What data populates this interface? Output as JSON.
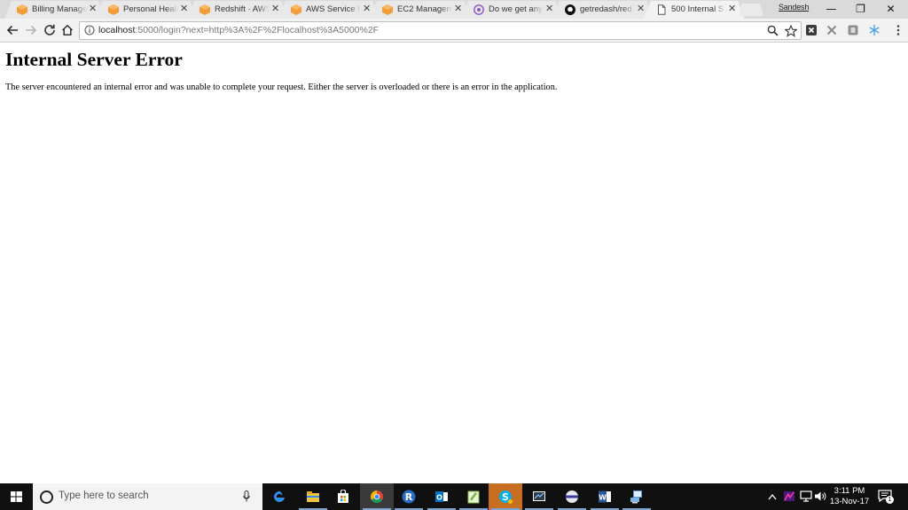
{
  "browser": {
    "tabs": [
      {
        "title": "Billing Manage",
        "icon": "aws-cube-icon",
        "active": false
      },
      {
        "title": "Personal Healt",
        "icon": "aws-cube-icon",
        "active": false
      },
      {
        "title": "Redshift · AWS",
        "icon": "aws-cube-icon",
        "active": false
      },
      {
        "title": "AWS Service H",
        "icon": "aws-cube-icon",
        "active": false
      },
      {
        "title": "EC2 Managem",
        "icon": "aws-cube-icon",
        "active": false
      },
      {
        "title": "Do we get any",
        "icon": "forum-icon",
        "active": false
      },
      {
        "title": "getredash/red",
        "icon": "github-icon",
        "active": false
      },
      {
        "title": "500 Internal S",
        "icon": "page-icon",
        "active": true
      }
    ],
    "close_glyph": "✕",
    "profile_name": "Sandesh",
    "window_controls": {
      "minimize": "—",
      "restore": "❐",
      "close": "✕"
    },
    "address": {
      "host": "localhost",
      "rest": ":5000/login?next=http%3A%2F%2Flocalhost%3A5000%2F"
    }
  },
  "page": {
    "heading": "Internal Server Error",
    "message": "The server encountered an internal error and was unable to complete your request. Either the server is overloaded or there is an error in the application."
  },
  "taskbar": {
    "search_placeholder": "Type here to search",
    "apps": [
      "edge-icon",
      "file-explorer-icon",
      "store-icon",
      "chrome-icon",
      "r-icon",
      "outlook-icon",
      "notepad-plus-icon",
      "skype-icon",
      "screen-capture-icon",
      "media-player-icon",
      "word-icon",
      "remote-desktop-icon"
    ],
    "time": "3:11 PM",
    "date": "13-Nov-17",
    "notification_count": "1",
    "colors": {
      "taskbar": "#101010",
      "accent": "#7aa7d8",
      "skype": "#c76e21"
    }
  }
}
